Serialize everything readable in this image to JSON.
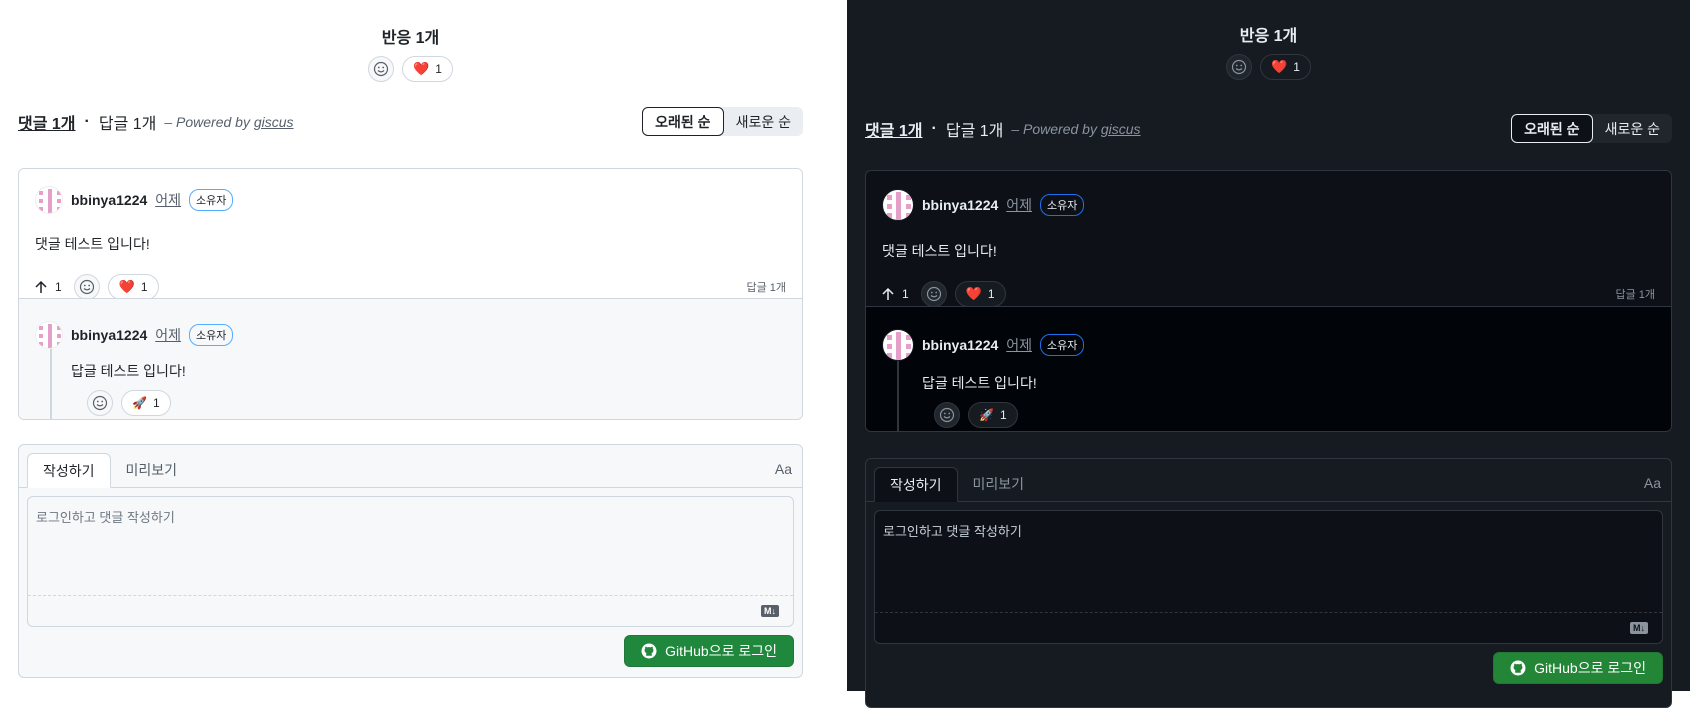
{
  "reactions": {
    "title": "반응 1개",
    "heart_emoji": "❤️",
    "heart_count": "1"
  },
  "counts": {
    "comments": "댓글 1개",
    "dot": "·",
    "replies": "답글 1개",
    "powered_prefix": "– Powered by",
    "powered_link": "giscus"
  },
  "sort": {
    "oldest": "오래된 순",
    "newest": "새로운 순"
  },
  "comment": {
    "author": "bbinya1224",
    "when": "어제",
    "badge": "소유자",
    "body": "댓글 테스트 입니다!",
    "upvotes": "1",
    "heart_emoji": "❤️",
    "heart_count": "1",
    "reply_count": "답글 1개"
  },
  "reply": {
    "author": "bbinya1224",
    "when": "어제",
    "badge": "소유자",
    "body": "답글 테스트 입니다!",
    "rocket_emoji": "🚀",
    "rocket_count": "1"
  },
  "editor": {
    "tab_write": "작성하기",
    "tab_preview": "미리보기",
    "font_toggle": "Aa",
    "placeholder": "로그인하고 댓글 작성하기",
    "markdown_badge": "M↓",
    "login_button": "GitHub으로 로그인"
  },
  "colors": {
    "light_bg": "#ffffff",
    "dark_bg": "#161b22",
    "login_green": "#1f883d",
    "heart": "#e0245e",
    "avatar_pink": "#e4a0c9"
  }
}
